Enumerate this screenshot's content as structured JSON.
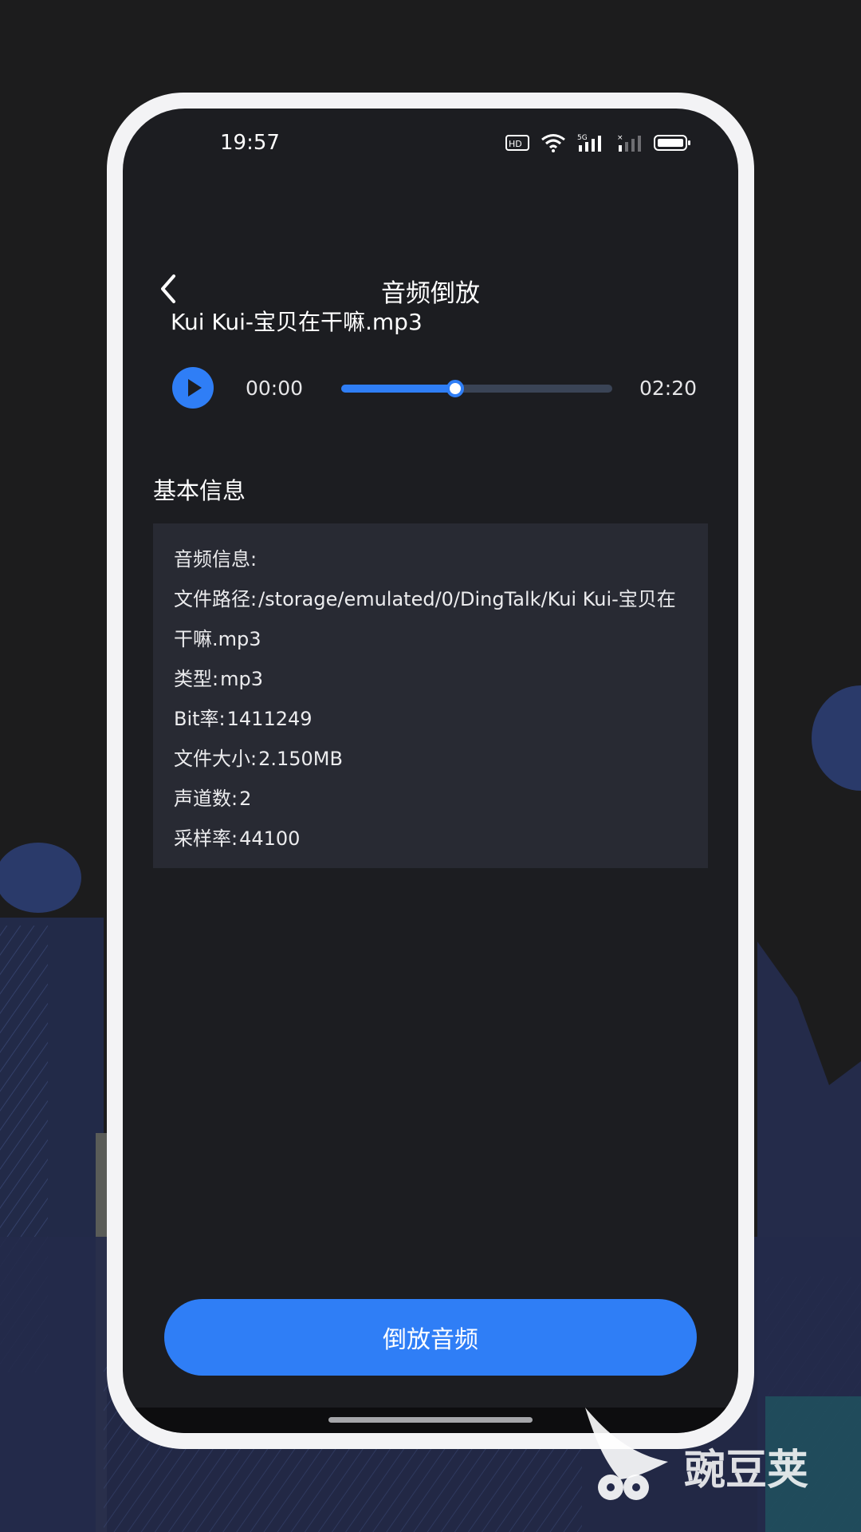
{
  "status_bar": {
    "time": "19:57",
    "hd_label": "HD",
    "network_label": "5G"
  },
  "nav": {
    "title": "音频倒放"
  },
  "player": {
    "file_name": "Kui Kui-宝贝在干嘛.mp3",
    "current_time": "00:00",
    "total_time": "02:20",
    "progress_fraction": 0.42
  },
  "info": {
    "section_title": "基本信息",
    "header": "音频信息:",
    "path_label": "文件路径:",
    "path_value": "/storage/emulated/0/DingTalk/Kui Kui-宝贝在干嘛.mp3",
    "type_label": "类型:",
    "type_value": "mp3",
    "bitrate_label": "Bit率:",
    "bitrate_value": "1411249",
    "size_label": "文件大小:",
    "size_value": "2.150MB",
    "channels_label": "声道数:",
    "channels_value": "2",
    "samplerate_label": "采样率:",
    "samplerate_value": "44100"
  },
  "action": {
    "reverse_label": "倒放音频"
  },
  "watermark": {
    "text": "豌豆荚"
  },
  "colors": {
    "accent": "#2f7ef6",
    "screen_bg": "#1c1d21",
    "card_bg": "#282a33",
    "page_bg": "#1c1c1d"
  }
}
